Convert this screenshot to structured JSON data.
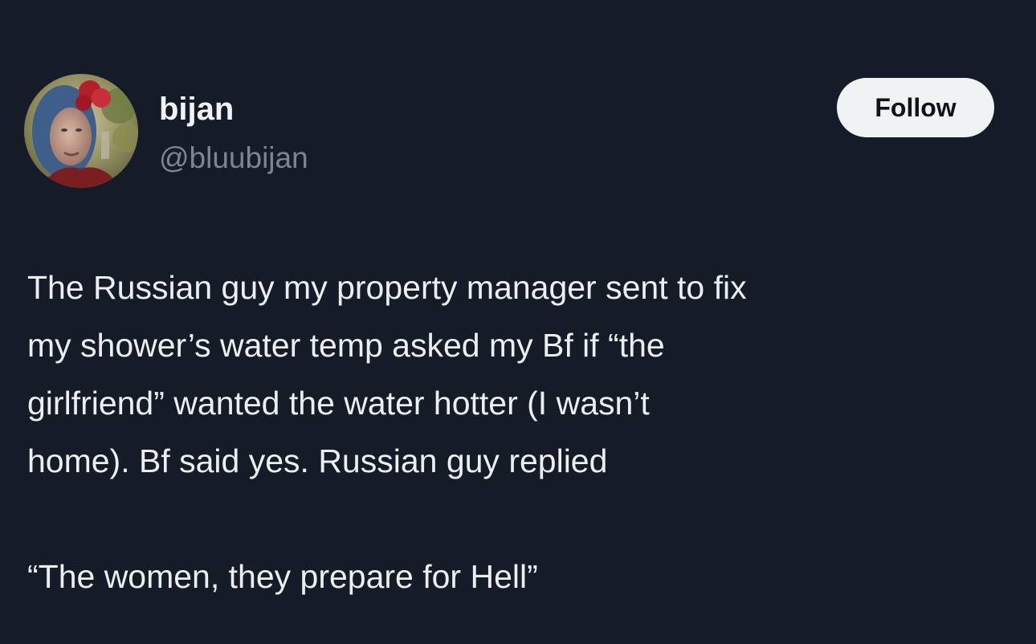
{
  "author": {
    "display_name": "bijan",
    "handle": "@bluubijan",
    "avatar": "profile-photo-avatar"
  },
  "actions": {
    "follow_label": "Follow"
  },
  "tweet": {
    "lines": [
      "The Russian guy my property manager sent to fix",
      "my shower’s water temp asked my Bf if “the",
      "girlfriend” wanted the water hotter (I wasn’t",
      "home). Bf said yes. Russian guy replied"
    ],
    "quote": "“The women, they prepare for Hell”"
  },
  "colors": {
    "background": "#151c28",
    "text": "#eceef0",
    "handle": "#7c8590",
    "follow_bg": "#eff3f4",
    "follow_text": "#0f1419"
  }
}
